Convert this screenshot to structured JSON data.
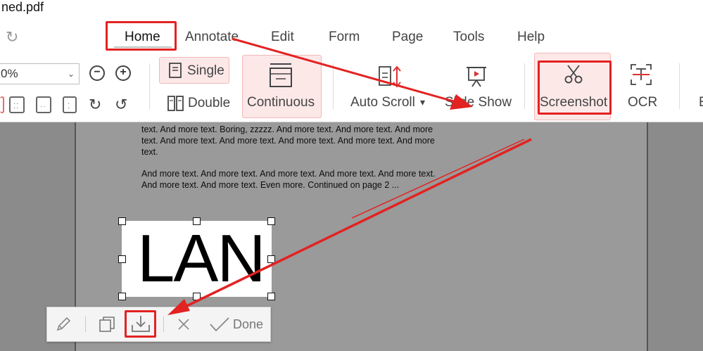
{
  "window": {
    "title": "ned.pdf"
  },
  "menu": {
    "items": [
      {
        "label": "Home",
        "active": true
      },
      {
        "label": "Annotate"
      },
      {
        "label": "Edit"
      },
      {
        "label": "Form"
      },
      {
        "label": "Page"
      },
      {
        "label": "Tools"
      },
      {
        "label": "Help"
      }
    ]
  },
  "ribbon": {
    "zoom_value": "0%",
    "single_label": "Single",
    "double_label": "Double",
    "continuous_label": "Continuous",
    "auto_scroll_label": "Auto Scroll",
    "slide_show_label": "Slide Show",
    "screenshot_label": "Screenshot",
    "ocr_label": "OCR",
    "cut_label": "E"
  },
  "document": {
    "paragraph1": "text. And more text. Boring, zzzzz. And more text. And more text. And more text. And more text. And more text. And more text. And more text. And more text.",
    "paragraph2": "And more text. And more text. And more text. And more text. And more text. And more text. And more text. Even more. Continued on page 2 ...",
    "logo_text": "LAN"
  },
  "screenshot_toolbar": {
    "done_label": "Done",
    "icons": [
      "pencil-icon",
      "copy-icon",
      "download-icon",
      "close-icon",
      "check-icon"
    ]
  },
  "colors": {
    "highlight_red": "#e32222",
    "active_pill": "#fde8e8",
    "doc_background": "#8b8b8b"
  }
}
